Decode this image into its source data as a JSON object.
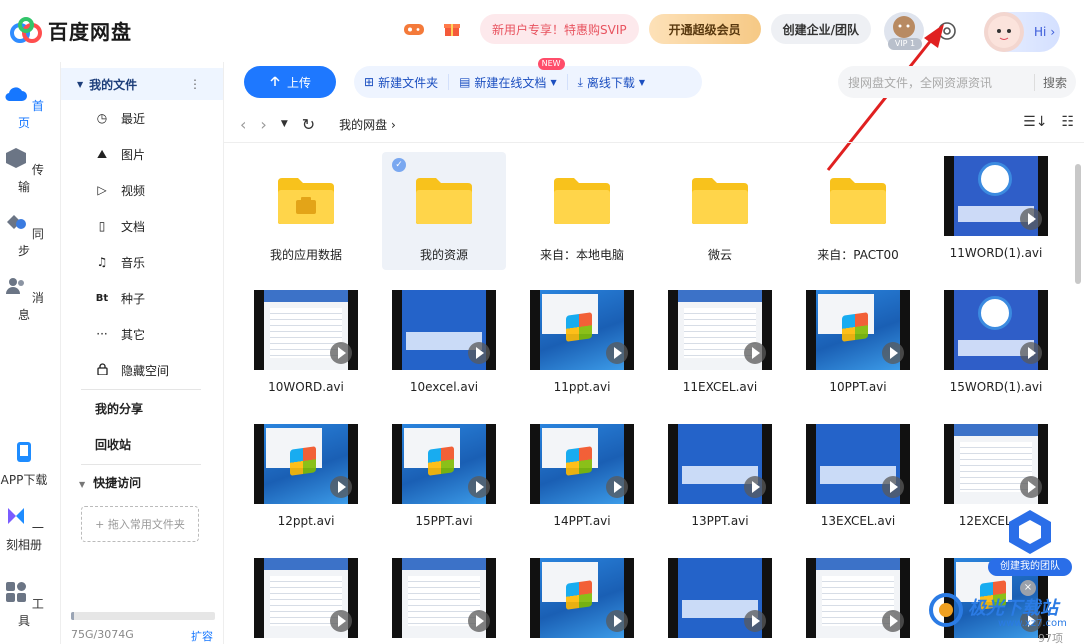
{
  "app": {
    "title": "百度网盘"
  },
  "header": {
    "promo": "新用户专享！特惠购SVIP",
    "vip_button": "开通超级会员",
    "team_button": "创建企业/团队",
    "vip_level": "VIP 1",
    "greeting": "Hi"
  },
  "leftnav": [
    {
      "label": "首页",
      "icon": "cloud-icon"
    },
    {
      "label": "传输",
      "icon": "transfer-icon"
    },
    {
      "label": "同步",
      "icon": "sync-icon"
    },
    {
      "label": "消息",
      "icon": "people-icon"
    },
    {
      "label": "APP下载",
      "icon": "phone-icon"
    },
    {
      "label": "一刻相册",
      "icon": "album-icon"
    },
    {
      "label": "工具",
      "icon": "tools-icon"
    }
  ],
  "sidebar": {
    "my_files": "我的文件",
    "items": [
      {
        "label": "最近",
        "icon": "◷"
      },
      {
        "label": "图片",
        "icon": "⛰"
      },
      {
        "label": "视频",
        "icon": "▷"
      },
      {
        "label": "文档",
        "icon": "▯"
      },
      {
        "label": "音乐",
        "icon": "♫"
      },
      {
        "label": "种子",
        "icon": "Bt"
      },
      {
        "label": "其它",
        "icon": "···"
      },
      {
        "label": "隐藏空间",
        "icon": "🔒"
      }
    ],
    "my_share": "我的分享",
    "recycle": "回收站",
    "quick_access": "快捷访问",
    "quick_add": "+ 拖入常用文件夹",
    "storage": "75G/3074G",
    "storage_fraction": 0.024,
    "expand": "扩容"
  },
  "toolbar": {
    "upload": "上传",
    "new_folder": "新建文件夹",
    "new_doc": "新建在线文档",
    "new_badge": "NEW",
    "offline": "离线下载",
    "search_placeholder": "搜网盘文件，全网资源资讯",
    "search_button": "搜索"
  },
  "breadcrumb": {
    "current": "我的网盘"
  },
  "files": [
    {
      "name": "我的应用数据",
      "kind": "folder-app"
    },
    {
      "name": "我的资源",
      "kind": "folder",
      "selected": true
    },
    {
      "name": "来自：本地电脑",
      "kind": "folder"
    },
    {
      "name": "微云",
      "kind": "folder"
    },
    {
      "name": "来自：PACT00",
      "kind": "folder"
    },
    {
      "name": "11WORD(1).avi",
      "kind": "logo"
    },
    {
      "name": "10WORD.avi",
      "kind": "doc"
    },
    {
      "name": "10excel.avi",
      "kind": "title"
    },
    {
      "name": "11ppt.avi",
      "kind": "win"
    },
    {
      "name": "11EXCEL.avi",
      "kind": "doc"
    },
    {
      "name": "10PPT.avi",
      "kind": "win"
    },
    {
      "name": "15WORD(1).avi",
      "kind": "logo"
    },
    {
      "name": "12ppt.avi",
      "kind": "win"
    },
    {
      "name": "15PPT.avi",
      "kind": "win"
    },
    {
      "name": "14PPT.avi",
      "kind": "win"
    },
    {
      "name": "13PPT.avi",
      "kind": "title"
    },
    {
      "name": "13EXCEL.avi",
      "kind": "title"
    },
    {
      "name": "12EXCEL.avi",
      "kind": "doc"
    },
    {
      "name": "",
      "kind": "doc"
    },
    {
      "name": "",
      "kind": "doc"
    },
    {
      "name": "",
      "kind": "win"
    },
    {
      "name": "",
      "kind": "title"
    },
    {
      "name": "",
      "kind": "doc"
    },
    {
      "name": "",
      "kind": "win"
    }
  ],
  "footer": {
    "count": "97项"
  },
  "float": {
    "team": "创建我的团队",
    "close": "×"
  },
  "watermark": {
    "text": "极光下载站",
    "url": "www.xz7.com"
  },
  "colors": {
    "accent": "#1e78ff",
    "promo": "#e8535f",
    "arrow": "#e02020"
  }
}
